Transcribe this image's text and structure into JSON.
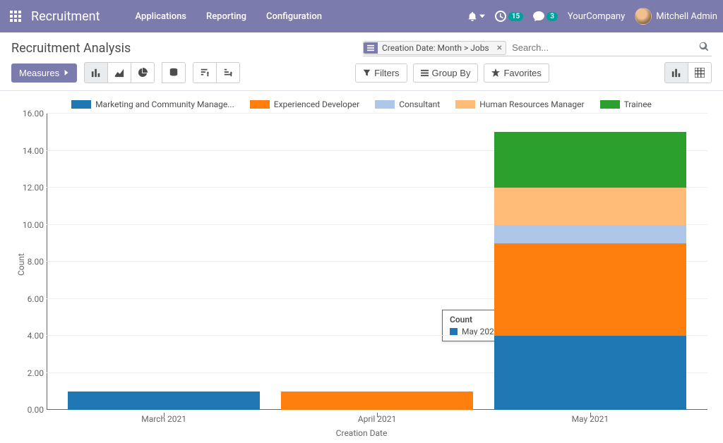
{
  "topnav": {
    "brand": "Recruitment",
    "menus": [
      "Applications",
      "Reporting",
      "Configuration"
    ],
    "activities_count": "15",
    "messages_count": "3",
    "company": "YourCompany",
    "user": "Mitchell Admin"
  },
  "control": {
    "title": "Recruitment Analysis",
    "facet_label": "Creation Date: Month > Jobs",
    "search_placeholder": "Search...",
    "measures_label": "Measures",
    "filters_label": "Filters",
    "groupby_label": "Group By",
    "favorites_label": "Favorites"
  },
  "legend": {
    "s1": "Marketing and Community Manage...",
    "s2": "Experienced Developer",
    "s3": "Consultant",
    "s4": "Human Resources Manager",
    "s5": "Trainee"
  },
  "colors": {
    "s1": "#1f77b4",
    "s2": "#ff7f0e",
    "s3": "#aec7e8",
    "s4": "#ffbb78",
    "s5": "#2ca02c"
  },
  "tooltip": {
    "title": "Count",
    "series_label": "May 2021/Marketing and Community Manager",
    "value": "4.00"
  },
  "axes": {
    "ylabel": "Count",
    "xlabel": "Creation Date",
    "ymax": 16,
    "ticks": [
      "0.00",
      "2.00",
      "4.00",
      "6.00",
      "8.00",
      "10.00",
      "12.00",
      "14.00",
      "16.00"
    ]
  },
  "chart_data": {
    "type": "bar",
    "stacked": true,
    "xlabel": "Creation Date",
    "ylabel": "Count",
    "ylim": [
      0,
      16
    ],
    "categories": [
      "March 2021",
      "April 2021",
      "May 2021"
    ],
    "series": [
      {
        "name": "Marketing and Community Manager",
        "color": "#1f77b4",
        "values": [
          1,
          0,
          4
        ]
      },
      {
        "name": "Experienced Developer",
        "color": "#ff7f0e",
        "values": [
          0,
          1,
          5
        ]
      },
      {
        "name": "Consultant",
        "color": "#aec7e8",
        "values": [
          0,
          0,
          1
        ]
      },
      {
        "name": "Human Resources Manager",
        "color": "#ffbb78",
        "values": [
          0,
          0,
          2
        ]
      },
      {
        "name": "Trainee",
        "color": "#2ca02c",
        "values": [
          0,
          0,
          3
        ]
      }
    ]
  }
}
